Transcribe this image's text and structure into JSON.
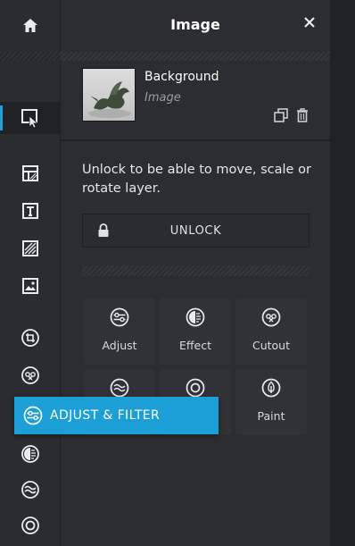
{
  "panel": {
    "title": "Image",
    "layer": {
      "name": "Background",
      "type": "Image"
    },
    "unlock_message": "Unlock to be able to move, scale or rotate layer.",
    "unlock_button": "UNLOCK",
    "tools": [
      {
        "label": "Adjust",
        "icon": "adjust-icon"
      },
      {
        "label": "Effect",
        "icon": "effect-icon"
      },
      {
        "label": "Cutout",
        "icon": "cutout-icon"
      },
      {
        "label": "",
        "icon": "distort-icon"
      },
      {
        "label": "",
        "icon": "vignette-icon"
      },
      {
        "label": "Paint",
        "icon": "paint-icon"
      }
    ]
  },
  "rail": {
    "items": [
      {
        "icon": "home-icon"
      },
      {
        "icon": "select-icon",
        "active": true
      },
      {
        "icon": "layout-icon"
      },
      {
        "icon": "text-icon"
      },
      {
        "icon": "texture-icon"
      },
      {
        "icon": "image-icon"
      },
      {
        "icon": "crop-rotate-icon"
      },
      {
        "icon": "cutout-icon"
      },
      {
        "icon": "adjust-filter-icon"
      },
      {
        "icon": "effect-icon"
      },
      {
        "icon": "distort-icon"
      },
      {
        "icon": "vignette-icon"
      }
    ]
  },
  "tooltip": {
    "label": "ADJUST & FILTER"
  },
  "colors": {
    "accent": "#1fa2d8",
    "panel_bg": "#2b2d31",
    "rail_bg": "#2a2c2f",
    "tile_bg": "#303237"
  }
}
